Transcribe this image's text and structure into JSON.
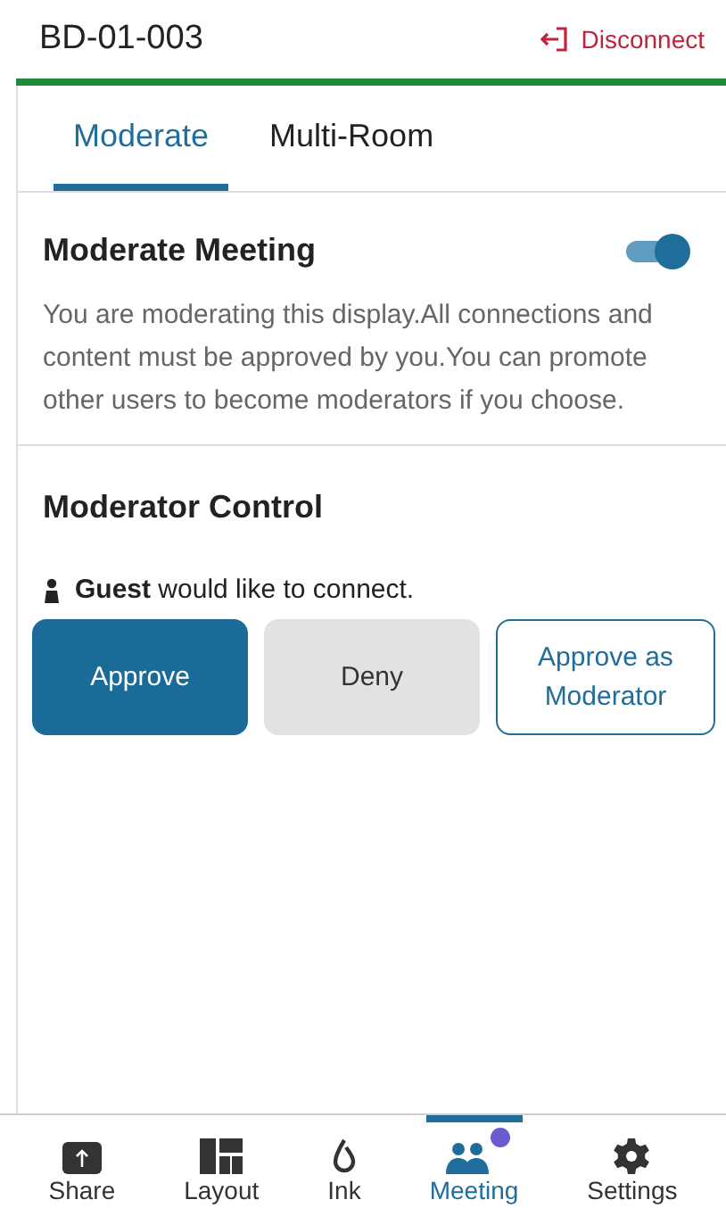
{
  "header": {
    "title": "BD-01-003",
    "action": "Disconnect"
  },
  "tabs": [
    {
      "label": "Moderate",
      "selected": true
    },
    {
      "label": "Multi-Room",
      "selected": false
    }
  ],
  "moderate": {
    "title": "Moderate Meeting",
    "on": true,
    "description": "You are moderating this display.All connections and content must be approved by you.You can promote other users to become moderators if you choose."
  },
  "control": {
    "title": "Moderator Control",
    "request": "**Guest** would like to connect.",
    "buttons": [
      {
        "label": "Approve",
        "kind": "primary"
      },
      {
        "label": "Deny",
        "kind": "secondary"
      },
      {
        "label": "Approve as Moderator",
        "kind": "outline"
      }
    ]
  },
  "nav": [
    {
      "label": "Share",
      "kind": "share",
      "selected": false
    },
    {
      "label": "Layout",
      "kind": "layout",
      "selected": false
    },
    {
      "label": "Ink",
      "kind": "ink",
      "selected": false
    },
    {
      "label": "Meeting",
      "kind": "meeting",
      "selected": true,
      "badge": true
    },
    {
      "label": "Settings",
      "kind": "settings",
      "selected": false
    }
  ]
}
